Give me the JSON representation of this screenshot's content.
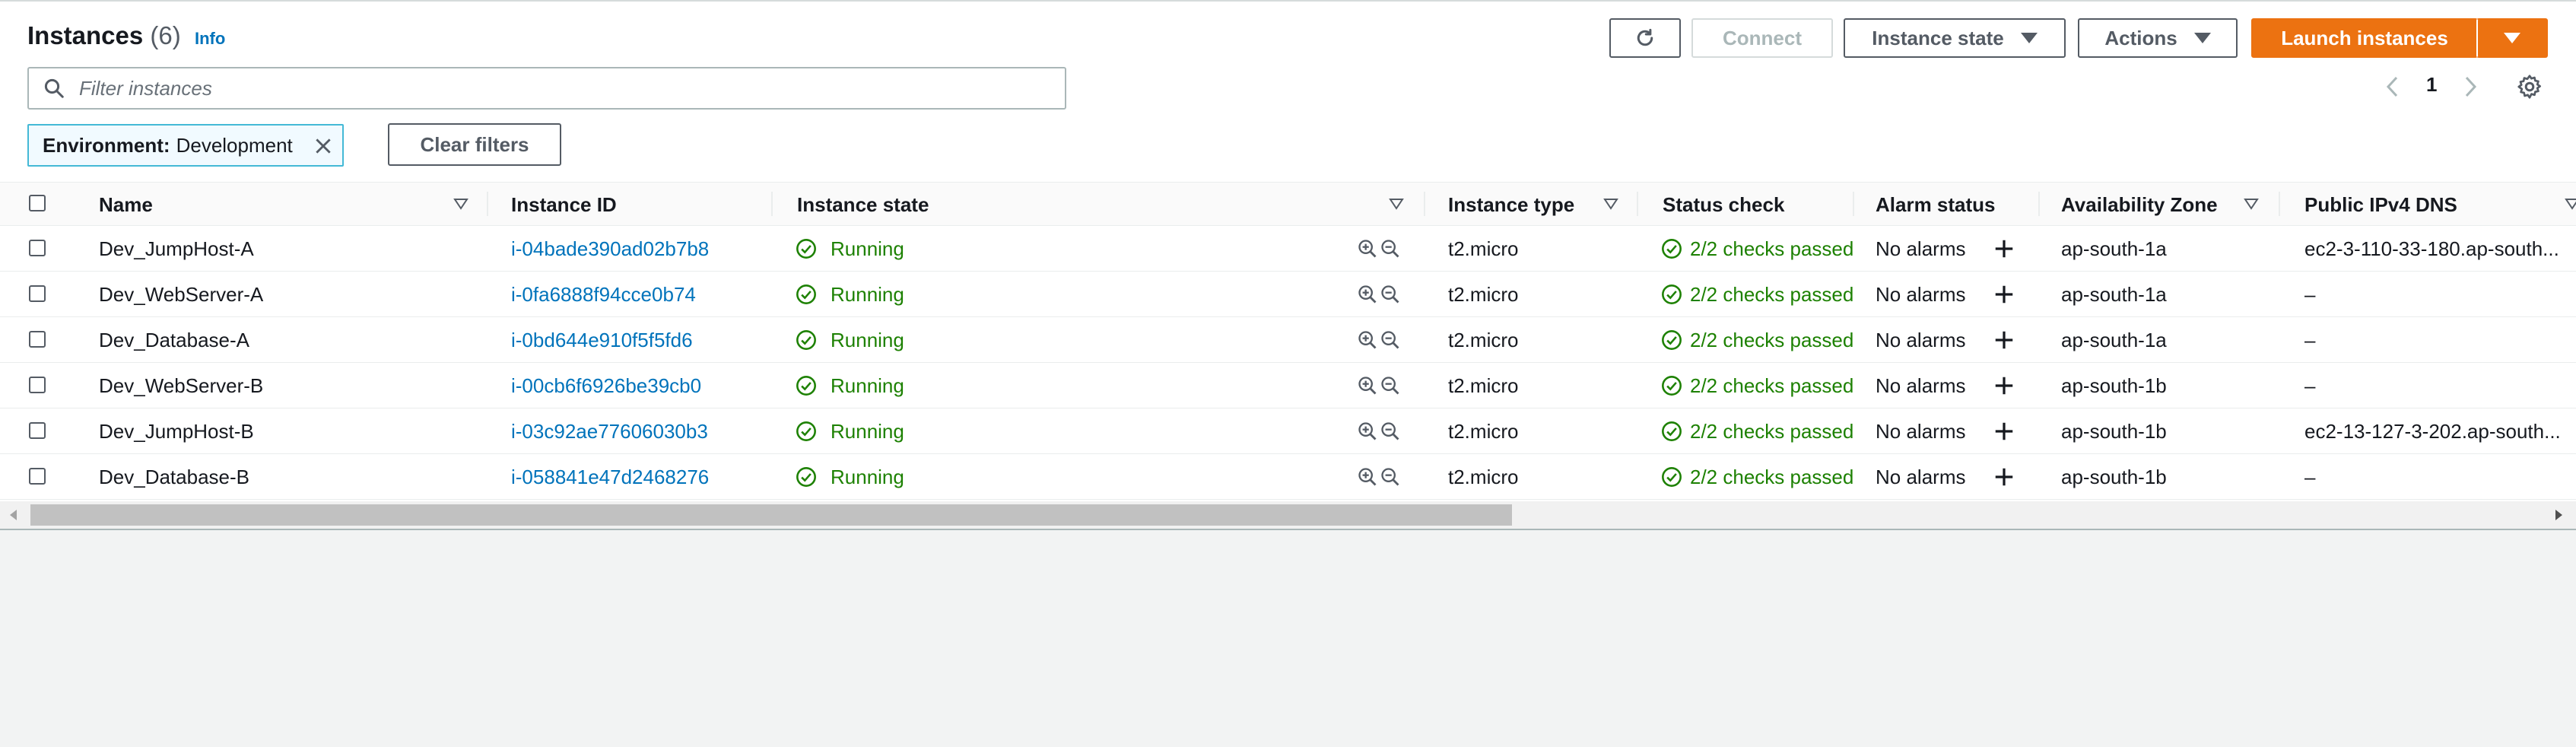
{
  "header": {
    "title": "Instances",
    "count": "(6)",
    "info": "Info",
    "buttons": {
      "refresh_icon": "refresh-icon",
      "connect": "Connect",
      "instance_state": "Instance state",
      "actions": "Actions",
      "launch": "Launch instances"
    }
  },
  "search": {
    "placeholder": "Filter instances"
  },
  "pagination": {
    "page": "1"
  },
  "filter_chip": {
    "key": "Environment:",
    "value": "Development"
  },
  "clear_filters": "Clear filters",
  "columns": [
    "Name",
    "Instance ID",
    "Instance state",
    "Instance type",
    "Status check",
    "Alarm status",
    "Availability Zone",
    "Public IPv4 DNS"
  ],
  "rows": [
    {
      "name": "Dev_JumpHost-A",
      "id": "i-04bade390ad02b7b8",
      "state": "Running",
      "type": "t2.micro",
      "status": "2/2 checks passed",
      "alarm": "No alarms",
      "zone": "ap-south-1a",
      "dns": "ec2-3-110-33-180.ap-south..."
    },
    {
      "name": "Dev_WebServer-A",
      "id": "i-0fa6888f94cce0b74",
      "state": "Running",
      "type": "t2.micro",
      "status": "2/2 checks passed",
      "alarm": "No alarms",
      "zone": "ap-south-1a",
      "dns": "–"
    },
    {
      "name": "Dev_Database-A",
      "id": "i-0bd644e910f5f5fd6",
      "state": "Running",
      "type": "t2.micro",
      "status": "2/2 checks passed",
      "alarm": "No alarms",
      "zone": "ap-south-1a",
      "dns": "–"
    },
    {
      "name": "Dev_WebServer-B",
      "id": "i-00cb6f6926be39cb0",
      "state": "Running",
      "type": "t2.micro",
      "status": "2/2 checks passed",
      "alarm": "No alarms",
      "zone": "ap-south-1b",
      "dns": "–"
    },
    {
      "name": "Dev_JumpHost-B",
      "id": "i-03c92ae77606030b3",
      "state": "Running",
      "type": "t2.micro",
      "status": "2/2 checks passed",
      "alarm": "No alarms",
      "zone": "ap-south-1b",
      "dns": "ec2-13-127-3-202.ap-south..."
    },
    {
      "name": "Dev_Database-B",
      "id": "i-058841e47d2468276",
      "state": "Running",
      "type": "t2.micro",
      "status": "2/2 checks passed",
      "alarm": "No alarms",
      "zone": "ap-south-1b",
      "dns": "–"
    }
  ],
  "colors": {
    "accent": "#ec7211",
    "link": "#0073bb",
    "success": "#1d8102",
    "chip_border": "#44b9d6"
  }
}
